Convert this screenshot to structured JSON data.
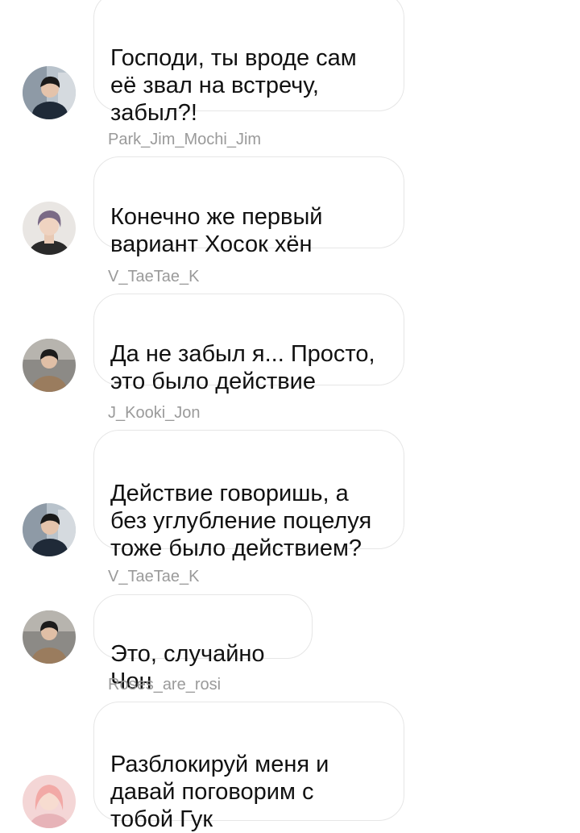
{
  "messages": [
    {
      "sender": "",
      "text": "Господи, ты вроде сам\nеё звал на встречу,\nзабыл?!",
      "avatar_icon": "user-avatar-icon"
    },
    {
      "sender": "Park_Jim_Mochi_Jim",
      "text": "Конечно же первый\nвариант Хосок хён",
      "avatar_icon": "user-avatar-icon"
    },
    {
      "sender": "V_TaeTae_K",
      "text": "Да не забыл я... Просто,\nэто было действие",
      "avatar_icon": "user-avatar-icon"
    },
    {
      "sender": "J_Kooki_Jon",
      "text": "Действие говоришь, а\nбез углубление поцелуя\nтоже было действием?",
      "avatar_icon": "user-avatar-icon"
    },
    {
      "sender": "V_TaeTae_K",
      "text": "Это, случайно Чон",
      "avatar_icon": "user-avatar-icon"
    },
    {
      "sender": "Roses_are_rosi",
      "text": "Разблокируй меня и\nдавай поговорим с\nтобой Гук",
      "avatar_icon": "user-avatar-icon"
    }
  ]
}
